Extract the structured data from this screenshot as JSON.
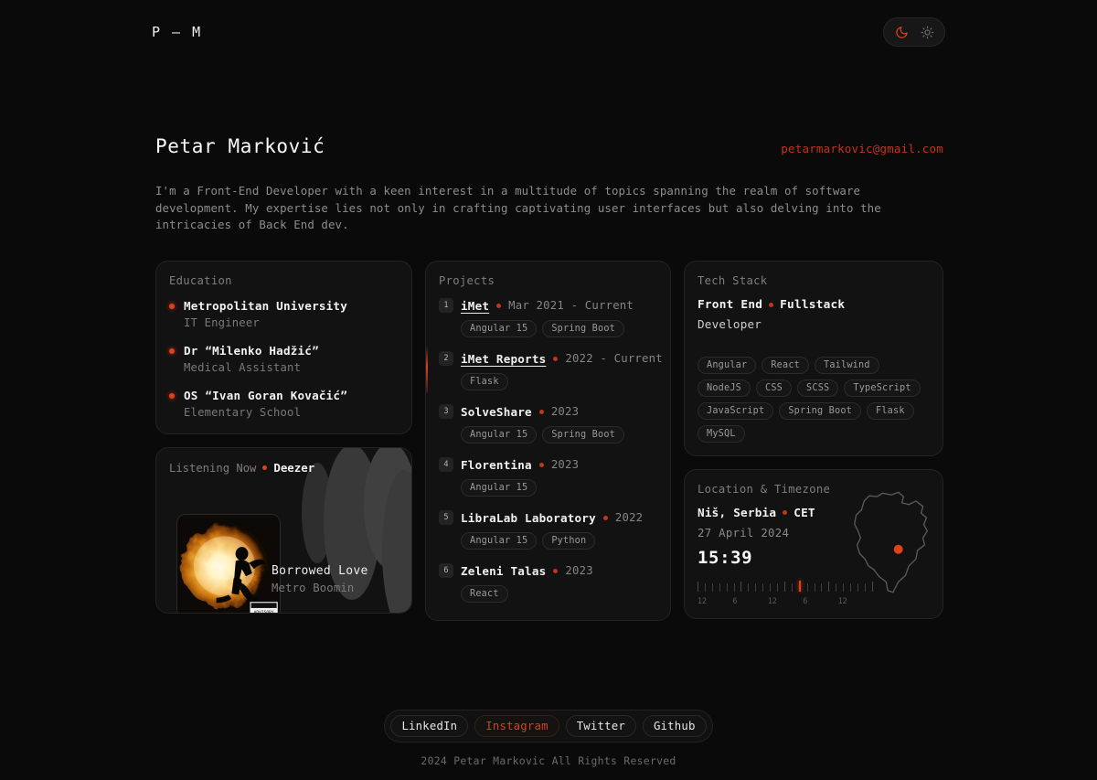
{
  "header": {
    "logo": "P — M",
    "theme": {
      "dark_icon": "moon-icon",
      "light_icon": "sun-icon",
      "active": "dark",
      "accent": "#e0401a"
    }
  },
  "intro": {
    "name": "Petar Marković",
    "email": "petarmarkovic@gmail.com",
    "bio": "I'm a Front-End Developer with a keen interest in a multitude of topics spanning the realm of software development. My expertise lies not only in crafting captivating user interfaces but also delving into the intricacies of Back End dev."
  },
  "education": {
    "label": "Education",
    "items": [
      {
        "title": "Metropolitan University",
        "subtitle": "IT Engineer"
      },
      {
        "title": "Dr “Milenko Hadžić”",
        "subtitle": "Medical Assistant"
      },
      {
        "title": "OS “Ivan Goran Kovačić”",
        "subtitle": "Elementary School"
      }
    ]
  },
  "music": {
    "label": "Listening Now",
    "service": "Deezer",
    "track_title": "Borrowed Love",
    "artist": "Metro Boomin",
    "album_art": "explosion-silhouette-album-art",
    "advisory": "PARENTAL ADVISORY EXPLICIT CONTENT"
  },
  "projects": {
    "label": "Projects",
    "items": [
      {
        "num": "1",
        "name": "iMet",
        "linked": true,
        "date": "Mar 2021 - Current",
        "tags": [
          "Angular 15",
          "Spring Boot"
        ]
      },
      {
        "num": "2",
        "name": "iMet Reports",
        "linked": true,
        "date": "2022 - Current",
        "tags": [
          "Flask"
        ]
      },
      {
        "num": "3",
        "name": "SolveShare",
        "linked": false,
        "date": "2023",
        "tags": [
          "Angular 15",
          "Spring Boot"
        ]
      },
      {
        "num": "4",
        "name": "Florentina",
        "linked": false,
        "date": "2023",
        "tags": [
          "Angular 15"
        ]
      },
      {
        "num": "5",
        "name": "LibraLab Laboratory",
        "linked": false,
        "date": "2022",
        "tags": [
          "Angular 15",
          "Python"
        ]
      },
      {
        "num": "6",
        "name": "Zeleni Talas",
        "linked": false,
        "date": "2023",
        "tags": [
          "React"
        ]
      }
    ]
  },
  "tech_stack": {
    "label": "Tech Stack",
    "role_primary": "Front End",
    "role_secondary": "Fullstack",
    "role_tertiary": "Developer",
    "tags": [
      "Angular",
      "React",
      "Tailwind",
      "NodeJS",
      "CSS",
      "SCSS",
      "TypeScript",
      "JavaScript",
      "Spring Boot",
      "Flask",
      "MySQL"
    ]
  },
  "location": {
    "label": "Location & Timezone",
    "city": "Niš, Serbia",
    "timezone": "CET",
    "date": "27 April 2024",
    "time": "15:39",
    "map": "serbia-map-outline",
    "marker": "location-marker",
    "ruler": {
      "tick_count": 25,
      "active_index": 14,
      "labels": [
        "12",
        "6",
        "12",
        "6",
        "12"
      ]
    }
  },
  "footer": {
    "socials": [
      {
        "label": "LinkedIn",
        "active": false
      },
      {
        "label": "Instagram",
        "active": true
      },
      {
        "label": "Twitter",
        "active": false
      },
      {
        "label": "Github",
        "active": false
      }
    ],
    "copyright": "2024 Petar Markovic All Rights Reserved"
  }
}
